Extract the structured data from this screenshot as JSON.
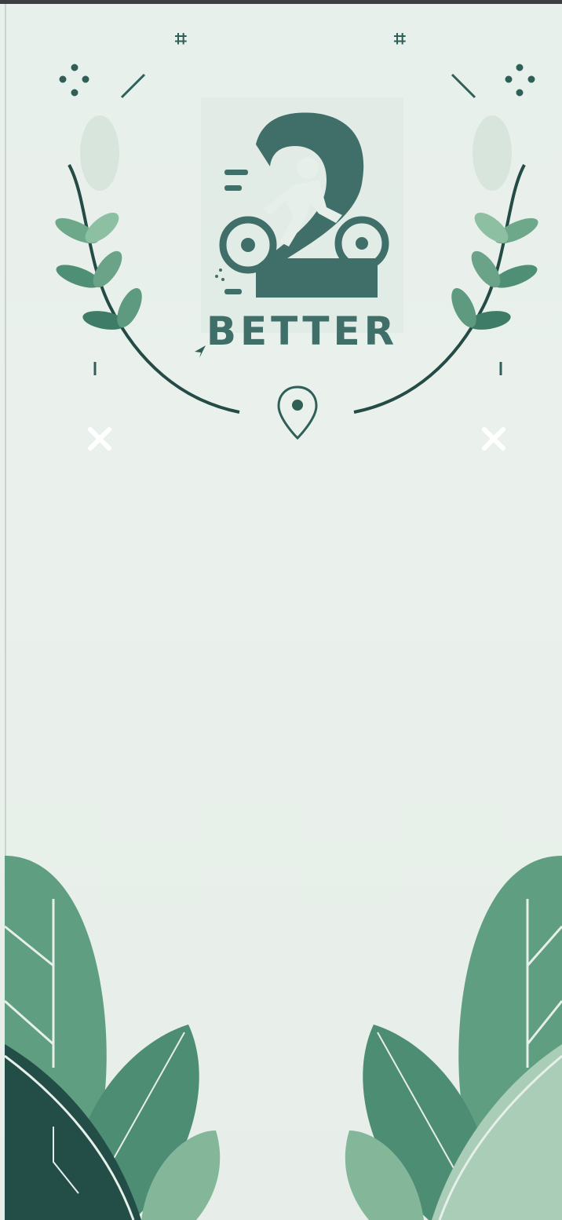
{
  "app": {
    "brand_text": "BETTER",
    "logo_numeral": "2",
    "accent_color": "#3f6f68",
    "leaf_color": "#5f9d7f",
    "dark_leaf_color": "#1f4f47",
    "background_color": "#e9efea"
  },
  "icons": {
    "location": "location-pin-icon",
    "close_left": "close-icon",
    "close_right": "close-icon",
    "logo": "cyclist-logo-icon",
    "sparkles": "sparkle-icon"
  }
}
